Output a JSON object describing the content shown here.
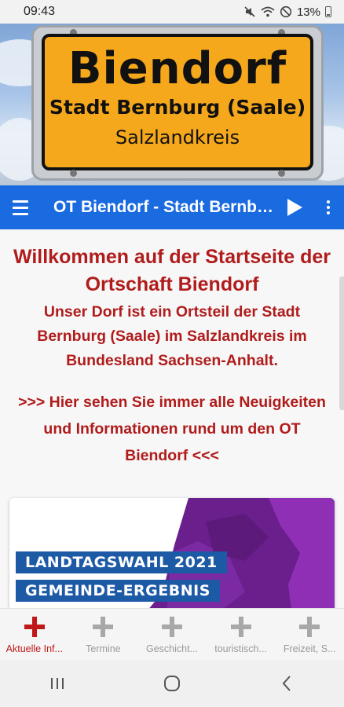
{
  "status": {
    "time": "09:43",
    "battery": "13%",
    "icons": [
      "mute-icon",
      "wifi-icon",
      "do-not-disturb-icon",
      "battery-icon"
    ]
  },
  "hero": {
    "sign_title": "Biendorf",
    "sign_line2": "Stadt Bernburg (Saale)",
    "sign_line3": "Salzlandkreis"
  },
  "appbar": {
    "title": "OT Biendorf - Stadt Bernburg (Saale)",
    "background": "#1a6ae0"
  },
  "content": {
    "heading": "Willkommen auf der Startseite der Ortschaft Biendorf",
    "intro": "Unser Dorf ist ein Ortsteil der Stadt Bernburg (Saale) im Salzlandkreis im Bundesland Sachsen-Anhalt.",
    "news_hint": ">>> Hier sehen Sie immer alle Neuigkeiten und Informationen rund um den OT Biendorf <<<",
    "text_color": "#b01c1c",
    "card": {
      "banner1": "LANDTAGSWAHL 2021",
      "banner2": "GEMEINDE-ERGEBNIS"
    }
  },
  "bottom_nav": [
    {
      "label": "Aktuelle Inf...",
      "active": true
    },
    {
      "label": "Termine",
      "active": false
    },
    {
      "label": "Geschicht...",
      "active": false
    },
    {
      "label": "touristisch...",
      "active": false
    },
    {
      "label": "Freizeit, S...",
      "active": false
    }
  ]
}
